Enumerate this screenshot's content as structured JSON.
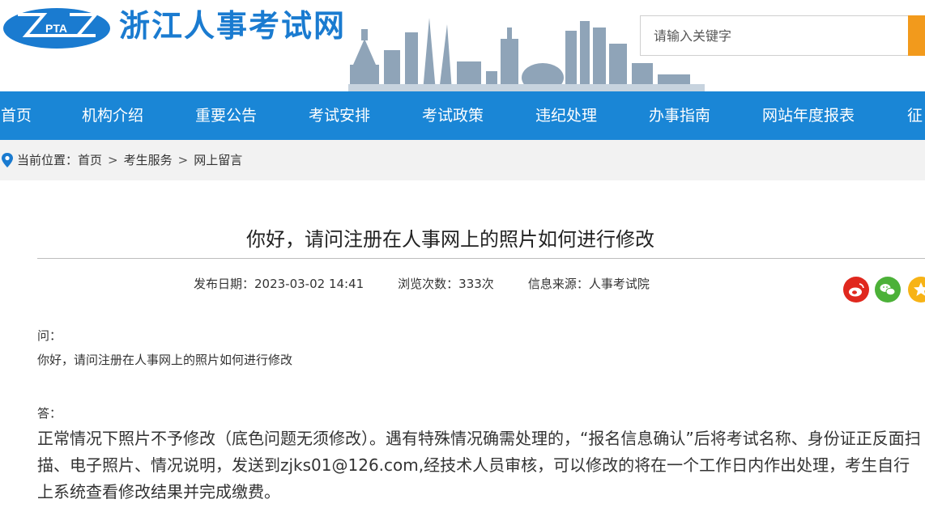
{
  "header": {
    "logo_text": "PTA",
    "site_title": "浙江人事考试网",
    "search_placeholder": "请输入关键字"
  },
  "nav": {
    "items": [
      "首页",
      "机构介绍",
      "重要公告",
      "考试安排",
      "考试政策",
      "违纪处理",
      "办事指南",
      "网站年度报表",
      "征"
    ]
  },
  "breadcrumb": {
    "prefix": "当前位置：",
    "items": [
      "首页",
      "考生服务",
      "网上留言"
    ],
    "separator": ">"
  },
  "article": {
    "title": "你好，请问注册在人事网上的照片如何进行修改",
    "meta": {
      "date": "发布日期：2023-03-02 14:41",
      "views": "浏览次数：333次",
      "source": "信息来源：人事考试院"
    },
    "question_label": "问：",
    "question": "你好，请问注册在人事网上的照片如何进行修改",
    "answer_label": "答：",
    "answer": "正常情况下照片不予修改（底色问题无须修改）。遇有特殊情况确需处理的，“报名信息确认”后将考试名称、身份证正反面扫描、电子照片、情况说明，发送到zjks01@126.com,经技术人员审核，可以修改的将在一个工作日内作出处理，考生自行上系统查看修改结果并完成缴费。"
  },
  "share": {
    "icons": [
      "weibo-icon",
      "wechat-icon",
      "favorite-icon"
    ]
  },
  "colors": {
    "brand_blue": "#1a86d6",
    "title_blue": "#1a7bd0",
    "search_orange": "#f29a1c",
    "weibo_red": "#e0281e",
    "wechat_green": "#4cb138",
    "fav_yellow": "#f7b316"
  }
}
